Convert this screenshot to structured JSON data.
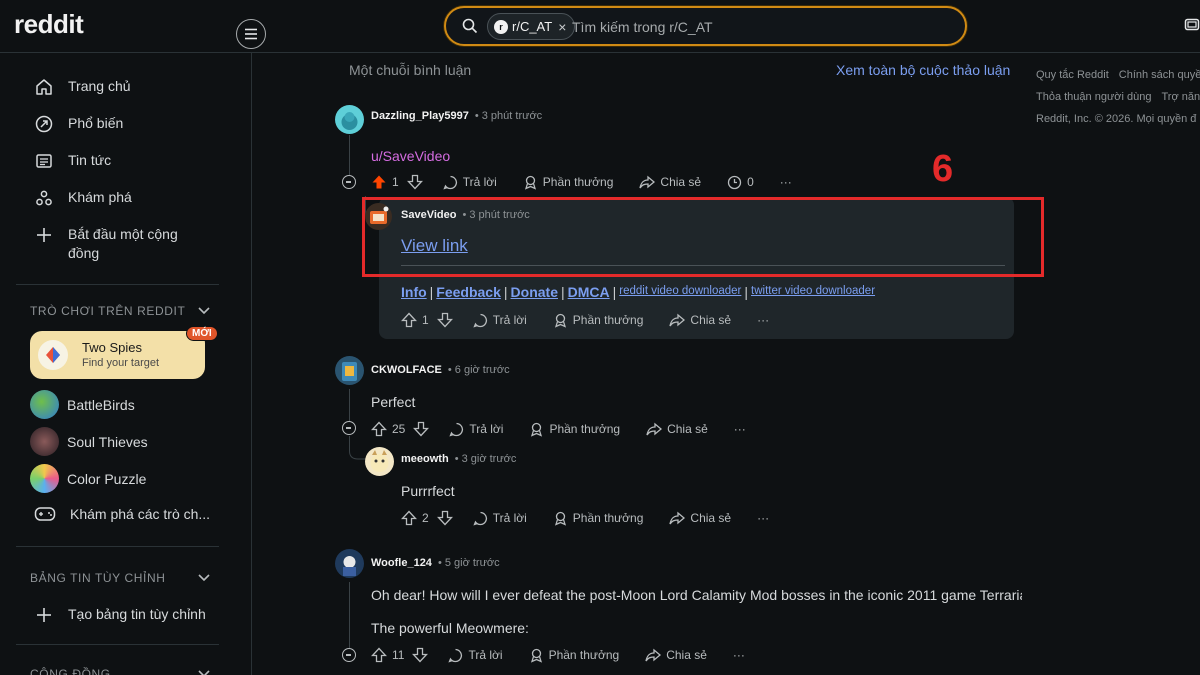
{
  "header": {
    "logo": "reddit",
    "search": {
      "chip_label": "r/C_AT",
      "chip_close": "×",
      "placeholder": "Tìm kiếm trong r/C_AT"
    }
  },
  "sidebar": {
    "nav": [
      {
        "label": "Trang chủ",
        "icon": "home-icon"
      },
      {
        "label": "Phổ biến",
        "icon": "popular-icon"
      },
      {
        "label": "Tin tức",
        "icon": "news-icon"
      },
      {
        "label": "Khám phá",
        "icon": "explore-icon"
      },
      {
        "label": "Bắt đầu một cộng đồng",
        "icon": "plus-icon"
      }
    ],
    "games_title": "TRÒ CHƠI TRÊN REDDIT",
    "featured_game": {
      "title": "Two Spies",
      "subtitle": "Find your target",
      "badge": "MỚI"
    },
    "games": [
      {
        "label": "BattleBirds"
      },
      {
        "label": "Soul Thieves"
      },
      {
        "label": "Color Puzzle"
      },
      {
        "label": "Khám phá các trò ch..."
      }
    ],
    "feeds_title": "BẢNG TIN TÙY CHỈNH",
    "create_feed": "Tạo bảng tin tùy chỉnh",
    "communities_title": "CỘNG ĐỒNG"
  },
  "main": {
    "thread_label": "Một chuỗi bình luận",
    "view_all": "Xem toàn bộ cuộc thảo luận",
    "actions": {
      "reply": "Trả lời",
      "award": "Phần thưởng",
      "share": "Chia sẻ",
      "more": "···"
    },
    "comments": [
      {
        "user": "Dazzling_Play5997",
        "time": "• 3 phút trước",
        "text": "u/SaveVideo",
        "votes": "1",
        "extra": "0"
      },
      {
        "user": "SaveVideo",
        "time": "• 3 phút trước",
        "text": "View link",
        "votes": "1",
        "links": [
          "Info",
          "Feedback",
          "Donate",
          "DMCA",
          "reddit video downloader",
          "twitter video downloader"
        ],
        "sep": "|"
      },
      {
        "user": "CKWOLFACE",
        "time": "• 6 giờ trước",
        "text": "Perfect",
        "votes": "25"
      },
      {
        "user": "meeowth",
        "time": "• 3 giờ trước",
        "text": "Purrrfect",
        "votes": "2"
      },
      {
        "user": "Woofle_124",
        "time": "• 5 giờ trước",
        "text": "Oh dear! How will I ever defeat the post-Moon Lord Calamity Mod bosses in the iconic 2011 game Terraria?",
        "text2": "The powerful Meowmere:",
        "votes": "11"
      }
    ]
  },
  "annotation": {
    "number": "6",
    "color": "#e42a2a"
  },
  "right_footer": {
    "row1": [
      "Quy tắc Reddit",
      "Chính sách quyền"
    ],
    "row2": [
      "Thỏa thuận người dùng",
      "Trợ năng"
    ],
    "row3": "Reddit, Inc. © 2026. Mọi quyền đ"
  },
  "colors": {
    "accent": "#d08a14",
    "link": "#7b9ef0",
    "upvote": "#ff4500"
  }
}
